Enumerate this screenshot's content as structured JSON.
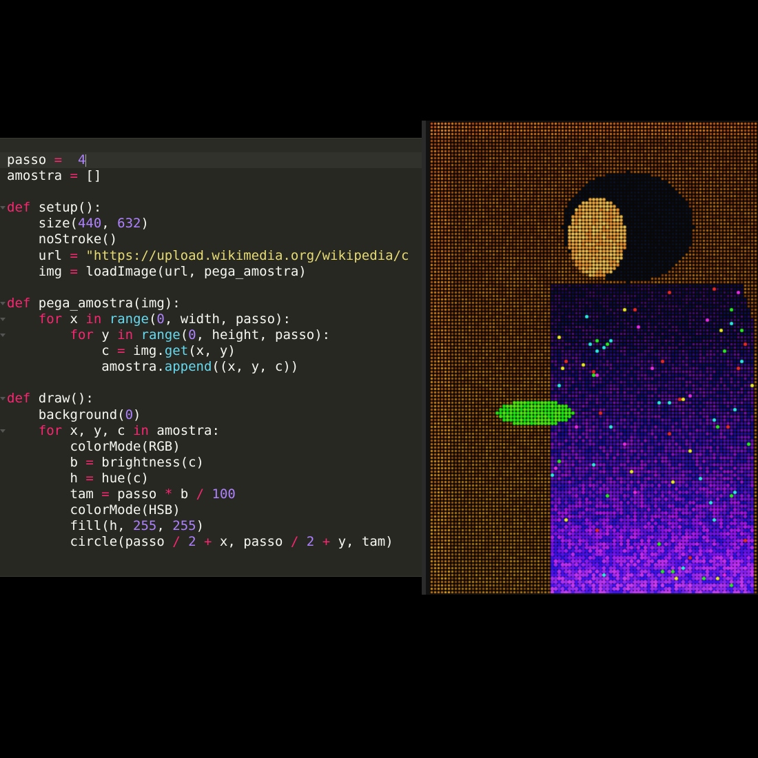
{
  "editor": {
    "lines": [
      [
        [
          "passo",
          "t"
        ],
        [
          " = ",
          "o"
        ],
        [
          " 4",
          "n"
        ]
      ],
      [
        [
          "amostra",
          "t"
        ],
        [
          " = ",
          "o"
        ],
        [
          "[]",
          "t"
        ]
      ],
      [],
      [
        [
          "def",
          "k"
        ],
        [
          " setup():",
          "t"
        ]
      ],
      [
        [
          "    size(",
          "t"
        ],
        [
          "440",
          "n"
        ],
        [
          ", ",
          "t"
        ],
        [
          "632",
          "n"
        ],
        [
          ")",
          "t"
        ]
      ],
      [
        [
          "    noStroke()",
          "t"
        ]
      ],
      [
        [
          "    url ",
          "t"
        ],
        [
          "=",
          "o"
        ],
        [
          " \"https://upload.wikimedia.org/wikipedia/c",
          "s"
        ]
      ],
      [
        [
          "    img ",
          "t"
        ],
        [
          "=",
          "o"
        ],
        [
          " loadImage(url, pega_amostra)",
          "t"
        ]
      ],
      [],
      [
        [
          "def",
          "k"
        ],
        [
          " pega_amostra(img):",
          "t"
        ]
      ],
      [
        [
          "    ",
          "t"
        ],
        [
          "for",
          "k"
        ],
        [
          " x ",
          "t"
        ],
        [
          "in",
          "k"
        ],
        [
          " ",
          "t"
        ],
        [
          "range",
          "f"
        ],
        [
          "(",
          "t"
        ],
        [
          "0",
          "n"
        ],
        [
          ", width, passo):",
          "t"
        ]
      ],
      [
        [
          "        ",
          "t"
        ],
        [
          "for",
          "k"
        ],
        [
          " y ",
          "t"
        ],
        [
          "in",
          "k"
        ],
        [
          " ",
          "t"
        ],
        [
          "range",
          "f"
        ],
        [
          "(",
          "t"
        ],
        [
          "0",
          "n"
        ],
        [
          ", height, passo):",
          "t"
        ]
      ],
      [
        [
          "            c ",
          "t"
        ],
        [
          "=",
          "o"
        ],
        [
          " img.",
          "t"
        ],
        [
          "get",
          "f"
        ],
        [
          "(x, y)",
          "t"
        ]
      ],
      [
        [
          "            amostra.",
          "t"
        ],
        [
          "append",
          "f"
        ],
        [
          "((x, y, c))",
          "t"
        ]
      ],
      [],
      [
        [
          "def",
          "k"
        ],
        [
          " draw():",
          "t"
        ]
      ],
      [
        [
          "    background(",
          "t"
        ],
        [
          "0",
          "n"
        ],
        [
          ")",
          "t"
        ]
      ],
      [
        [
          "    ",
          "t"
        ],
        [
          "for",
          "k"
        ],
        [
          " x, y, c ",
          "t"
        ],
        [
          "in",
          "k"
        ],
        [
          " amostra:",
          "t"
        ]
      ],
      [
        [
          "        colorMode(RGB)",
          "t"
        ]
      ],
      [
        [
          "        b ",
          "t"
        ],
        [
          "=",
          "o"
        ],
        [
          " brightness(c)",
          "t"
        ]
      ],
      [
        [
          "        h ",
          "t"
        ],
        [
          "=",
          "o"
        ],
        [
          " hue(c)",
          "t"
        ]
      ],
      [
        [
          "        tam ",
          "t"
        ],
        [
          "=",
          "o"
        ],
        [
          " passo ",
          "t"
        ],
        [
          "*",
          "o"
        ],
        [
          " b ",
          "t"
        ],
        [
          "/",
          "o"
        ],
        [
          " ",
          "t"
        ],
        [
          "100",
          "n"
        ]
      ],
      [
        [
          "        colorMode(HSB)",
          "t"
        ]
      ],
      [
        [
          "        fill(h, ",
          "t"
        ],
        [
          "255",
          "n"
        ],
        [
          ", ",
          "t"
        ],
        [
          "255",
          "n"
        ],
        [
          ")",
          "t"
        ]
      ],
      [
        [
          "        circle(passo ",
          "t"
        ],
        [
          "/",
          "o"
        ],
        [
          " ",
          "t"
        ],
        [
          "2",
          "n"
        ],
        [
          " ",
          "t"
        ],
        [
          "+",
          "o"
        ],
        [
          " x, passo ",
          "t"
        ],
        [
          "/",
          "o"
        ],
        [
          " ",
          "t"
        ],
        [
          "2",
          "n"
        ],
        [
          " ",
          "t"
        ],
        [
          "+",
          "o"
        ],
        [
          " y, tam)",
          "t"
        ]
      ]
    ]
  },
  "colors": {
    "editor_bg": "#272822",
    "keyword": "#f92672",
    "number": "#ae81ff",
    "string": "#e6db74",
    "function": "#66d9ef",
    "text": "#f8f8f2"
  },
  "icons": {
    "fold_marker": "triangle-down-icon"
  }
}
